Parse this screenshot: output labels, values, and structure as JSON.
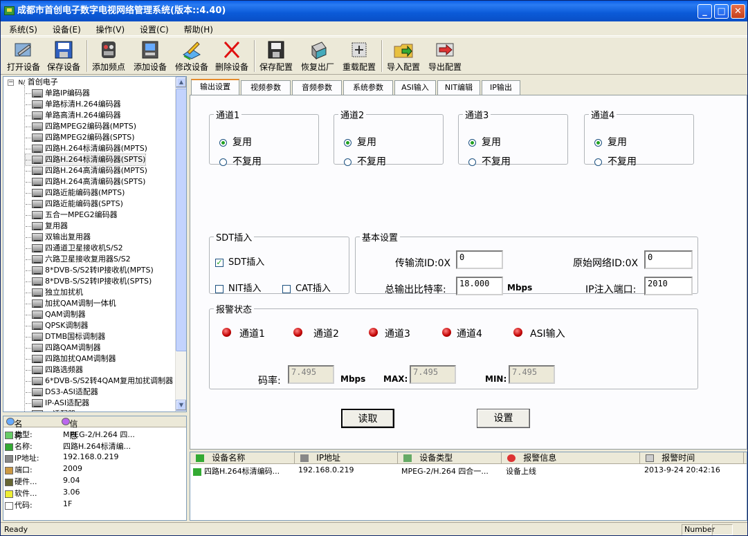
{
  "window": {
    "title": "成都市首创电子数字电视网络管理系统(版本::4.40)"
  },
  "menu": [
    "系统(S)",
    "设备(E)",
    "操作(V)",
    "设置(C)",
    "帮助(H)"
  ],
  "toolbar": [
    {
      "label": "打开设备",
      "icon": "open-device-icon"
    },
    {
      "label": "保存设备",
      "icon": "save-device-icon"
    },
    {
      "label": "添加频点",
      "icon": "add-frequency-icon"
    },
    {
      "label": "添加设备",
      "icon": "add-device-icon"
    },
    {
      "label": "修改设备",
      "icon": "edit-device-icon"
    },
    {
      "label": "删除设备",
      "icon": "delete-device-icon"
    },
    {
      "label": "保存配置",
      "icon": "save-config-icon"
    },
    {
      "label": "恢复出厂",
      "icon": "factory-reset-icon"
    },
    {
      "label": "重载配置",
      "icon": "reload-config-icon"
    },
    {
      "label": "导入配置",
      "icon": "import-config-icon"
    },
    {
      "label": "导出配置",
      "icon": "export-config-icon"
    }
  ],
  "tree": {
    "root": "首创电子",
    "root_prefix": "N/",
    "selected_index": 6,
    "items": [
      "单路IP编码器",
      "单路标清H.264编码器",
      "单路高清H.264编码器",
      "四路MPEG2编码器(MPTS)",
      "四路MPEG2编码器(SPTS)",
      "四路H.264标清编码器(MPTS)",
      "四路H.264标清编码器(SPTS)",
      "四路H.264高清编码器(MPTS)",
      "四路H.264高清编码器(SPTS)",
      "四路近能编码器(MPTS)",
      "四路近能编码器(SPTS)",
      "五合一MPEG2编码器",
      "复用器",
      "双输出复用器",
      "四通道卫星接收机S/S2",
      "六路卫星接收复用器S/S2",
      "8*DVB-S/S2转IP接收机(MPTS)",
      "8*DVB-S/S2转IP接收机(SPTS)",
      "独立加扰机",
      "加扰QAM调制一体机",
      "QAM调制器",
      "QPSK调制器",
      "DTMB国标调制器",
      "四路QAM调制器",
      "四路加扰QAM调制器",
      "四路选频器",
      "6*DVB-S/S2转4QAM复用加扰调制器",
      "DS3-ASI适配器",
      "IP-ASI适配器",
      "…适配器"
    ]
  },
  "props": {
    "header": {
      "name": "名称",
      "info": "信息"
    },
    "rows": [
      {
        "key": "类型:",
        "value": "MPEG-2/H.264 四..."
      },
      {
        "key": "名称:",
        "value": "四路H.264标清编..."
      },
      {
        "key": "IP地址:",
        "value": "192.168.0.219"
      },
      {
        "key": "端口:",
        "value": "2009"
      },
      {
        "key": "硬件...",
        "value": "9.04"
      },
      {
        "key": "软件...",
        "value": "3.06"
      },
      {
        "key": "代码:",
        "value": "1F"
      }
    ]
  },
  "tabs": [
    "输出设置",
    "视频参数",
    "音频参数",
    "系统参数",
    "ASI输入",
    "NIT编辑",
    "IP输出"
  ],
  "channels": [
    {
      "title": "通道1",
      "opt1": "复用",
      "opt2": "不复用"
    },
    {
      "title": "通道2",
      "opt1": "复用",
      "opt2": "不复用"
    },
    {
      "title": "通道3",
      "opt1": "复用",
      "opt2": "不复用"
    },
    {
      "title": "通道4",
      "opt1": "复用",
      "opt2": "不复用"
    }
  ],
  "sdt": {
    "title": "SDT插入",
    "sdt_label": "SDT插入",
    "nit_label": "NIT插入",
    "cat_label": "CAT插入",
    "check_mark": "✓"
  },
  "basic": {
    "title": "基本设置",
    "ts_id_label": "传输流ID:0X",
    "ts_id_value": "0",
    "net_id_label": "原始网络ID:0X",
    "net_id_value": "0",
    "bitrate_label": "总输出比特率:",
    "bitrate_value": "18.000",
    "bitrate_unit": "Mbps",
    "port_label": "IP注入端口:",
    "port_value": "2010"
  },
  "alarm": {
    "title": "报警状态",
    "leds": [
      "通道1",
      "通道2",
      "通道3",
      "通道4",
      "ASI输入"
    ],
    "rate_label": "码率:",
    "rate_value": "7.495",
    "rate_unit": "Mbps",
    "max_label": "MAX:",
    "max_value": "7.495",
    "min_label": "MIN:",
    "min_value": "7.495"
  },
  "buttons": {
    "read": "读取",
    "set": "设置"
  },
  "list": {
    "columns": [
      "设备名称",
      "IP地址",
      "设备类型",
      "报警信息",
      "报警时间"
    ],
    "rows": [
      [
        "四路H.264标清编码...",
        "192.168.0.219",
        "MPEG-2/H.264 四合一...",
        "设备上线",
        "2013-9-24 20:42:16"
      ]
    ]
  },
  "status": {
    "text": "Ready",
    "num": "Number"
  }
}
